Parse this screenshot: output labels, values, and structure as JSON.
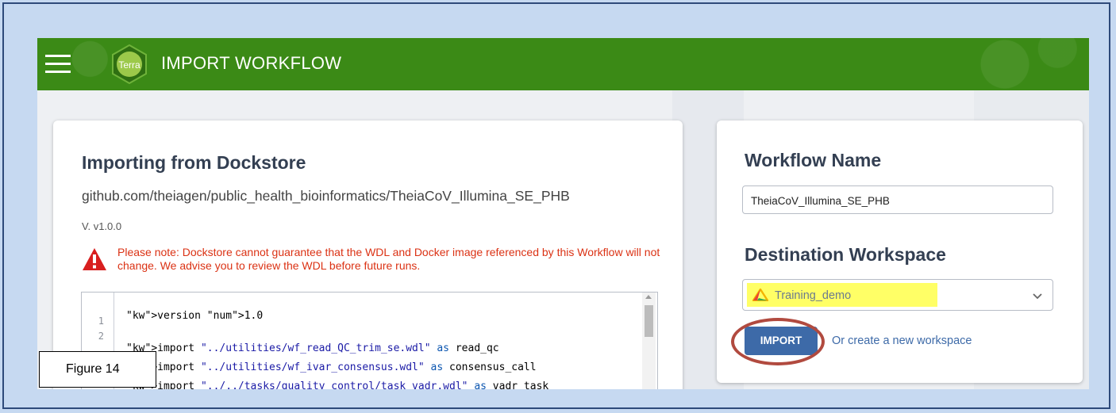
{
  "header": {
    "logo_text": "Terra",
    "title": "IMPORT WORKFLOW"
  },
  "left_panel": {
    "heading": "Importing from Dockstore",
    "repo_path": "github.com/theiagen/public_health_bioinformatics/TheiaCoV_Illumina_SE_PHB",
    "version": "V. v1.0.0",
    "warning": "Please note: Dockstore cannot guarantee that the WDL and Docker image referenced by this Workflow will not change. We advise you to review the WDL before future runs.",
    "code_lines": [
      {
        "num": "1",
        "text": "version 1.0"
      },
      {
        "num": "2",
        "text": ""
      },
      {
        "num": "",
        "text": "import \"../utilities/wf_read_QC_trim_se.wdl\" as read_qc"
      },
      {
        "num": "",
        "text": "import \"../utilities/wf_ivar_consensus.wdl\" as consensus_call"
      },
      {
        "num": "",
        "text": "import \"../../tasks/quality_control/task_vadr.wdl\" as vadr_task"
      }
    ]
  },
  "right_panel": {
    "workflow_name_heading": "Workflow Name",
    "workflow_name_value": "TheiaCoV_Illumina_SE_PHB",
    "destination_heading": "Destination Workspace",
    "workspace_selected": "Training_demo",
    "import_button": "IMPORT",
    "create_link": "Or create a new workspace"
  },
  "figure_label": "Figure 14",
  "colors": {
    "header_green": "#3b8a16",
    "import_blue": "#3d6aa8",
    "warning_red": "#db3214",
    "highlight_yellow": "#ffff66",
    "annotation_ring": "#b14a3f"
  }
}
